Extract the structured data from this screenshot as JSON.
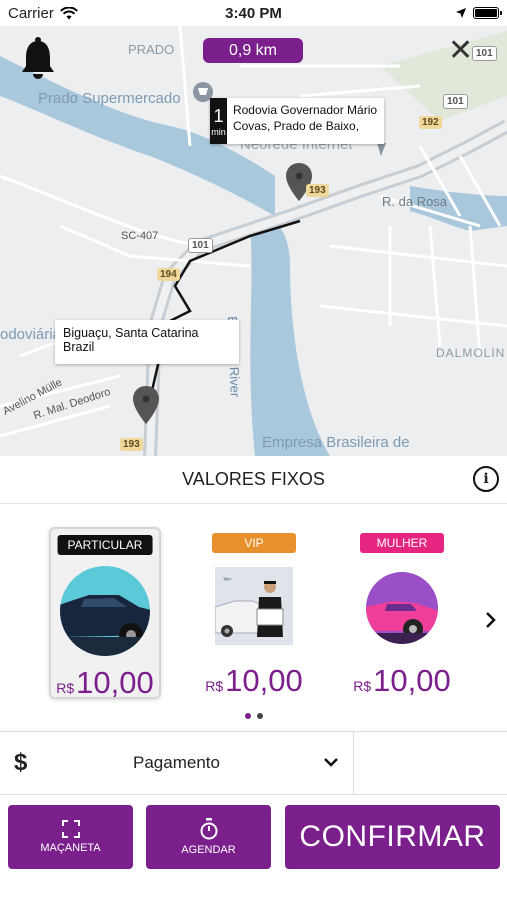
{
  "status_bar": {
    "carrier": "Carrier",
    "time": "3:40 PM"
  },
  "map": {
    "distance": "0,9 km",
    "eta": {
      "value": "1",
      "unit": "min",
      "destination": "Rodovia Governador Mário Covas, Prado de Baixo,"
    },
    "origin": "Biguaçu, Santa Catarina Brazil",
    "labels": {
      "prado": "PRADO",
      "supermercado": "Prado Supermercado",
      "neorede": "Neorede Internet",
      "rua_rosa": "R. da Rosa",
      "sc407": "SC-407",
      "rodoviaria": "odoviária",
      "river": "Biguaçu River",
      "dalmolin": "DALMOLIN",
      "deodoro": "R. Mal. Deodoro",
      "avelino": "Avelino Mülle",
      "empresa": "Empresa Brasileira de",
      "shield_101a": "101",
      "shield_101b": "101",
      "shield_101c": "101",
      "shield_192": "192",
      "shield_193a": "193",
      "shield_193b": "193",
      "shield_194": "194"
    }
  },
  "section": {
    "title": "VALORES FIXOS"
  },
  "cards": [
    {
      "badge": "PARTICULAR",
      "badge_color": "#111111",
      "currency": "R$",
      "price": "10,00",
      "selected": true
    },
    {
      "badge": "VIP",
      "badge_color": "#e8912c",
      "currency": "R$",
      "price": "10,00",
      "selected": false
    },
    {
      "badge": "MULHER",
      "badge_color": "#e5257f",
      "currency": "R$",
      "price": "10,00",
      "selected": false
    }
  ],
  "pagination": {
    "current": 1,
    "total": 2
  },
  "payment": {
    "icon": "dollar-icon",
    "label": "Pagamento"
  },
  "actions": {
    "macaneta": "MAÇANETA",
    "agendar": "AGENDAR",
    "confirmar": "CONFIRMAR"
  },
  "colors": {
    "accent": "#7b1f8c"
  }
}
